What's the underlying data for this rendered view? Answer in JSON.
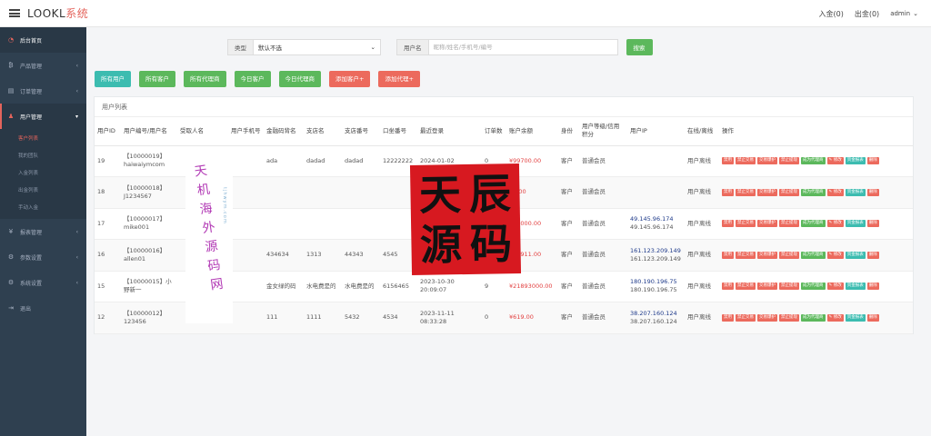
{
  "header": {
    "logo_main": "LOOKL",
    "logo_sys": "系统",
    "deposit": "入金(0)",
    "withdraw": "出金(0)",
    "user": "admin",
    "user_caret": "⌄"
  },
  "sidebar": {
    "items": [
      {
        "label": "后台首页",
        "icon": "dashboard-icon",
        "glyph": "◔"
      },
      {
        "label": "产品管理",
        "icon": "bitcoin-icon",
        "glyph": "₿"
      },
      {
        "label": "订单管理",
        "icon": "order-icon",
        "glyph": "▤"
      },
      {
        "label": "用户管理",
        "icon": "user-icon",
        "glyph": "♟"
      },
      {
        "label": "报表管理",
        "icon": "yen-icon",
        "glyph": "¥"
      },
      {
        "label": "参数设置",
        "icon": "settings-icon",
        "glyph": "⚙"
      },
      {
        "label": "系统设置",
        "icon": "gears-icon",
        "glyph": "⚙"
      },
      {
        "label": "退出",
        "icon": "logout-icon",
        "glyph": "⇥"
      }
    ],
    "submenu": [
      "客户列表",
      "我的团队",
      "入金列表",
      "出金列表",
      "手动入金"
    ]
  },
  "filter": {
    "type_label": "类型",
    "type_value": "默认不选",
    "user_label": "用户名",
    "user_placeholder": "昵称/姓名/手机号/编号",
    "search_btn": "搜索"
  },
  "tabs": [
    {
      "label": "所有用户",
      "color": "teal"
    },
    {
      "label": "所有客户",
      "color": "green"
    },
    {
      "label": "所有代理商",
      "color": "green"
    },
    {
      "label": "今日客户",
      "color": "green"
    },
    {
      "label": "今日代理商",
      "color": "green"
    },
    {
      "label": "添加客户+",
      "color": "red"
    },
    {
      "label": "添加代理+",
      "color": "red"
    }
  ],
  "panel_title": "用户列表",
  "table": {
    "headers": [
      "用户ID",
      "用户编号/用户名",
      "受取人名",
      "用户手机号",
      "金融码背名",
      "支店名",
      "支店番号",
      "口坐番号",
      "最近登录",
      "订单数",
      "账户余额",
      "身份",
      "用户等级/信用积分",
      "用户IP",
      "在线/离线",
      "操作"
    ],
    "rows": [
      {
        "id": "19",
        "name": "【10000019】haiwaiymcom",
        "recv": "",
        "phone": "",
        "bank": "ada",
        "branch": "dadad",
        "branch_no": "dadad",
        "acct": "12222222",
        "login": "2024-01-02",
        "orders": "0",
        "balance": "¥99700.00",
        "role": "客户",
        "level": "普通会员",
        "ip1": "",
        "ip2": "",
        "online": "用户离线"
      },
      {
        "id": "18",
        "name": "【10000018】J1234567",
        "recv": "",
        "phone": "",
        "bank": "",
        "branch": "",
        "branch_no": "",
        "acct": "",
        "login": "2024-01-0",
        "orders": "",
        "balance": "¥0.00",
        "role": "客户",
        "level": "普通会员",
        "ip1": "",
        "ip2": "",
        "online": "用户离线"
      },
      {
        "id": "17",
        "name": "【10000017】mike001",
        "recv": "",
        "phone": "",
        "bank": "",
        "branch": "",
        "branch_no": "",
        "acct": "",
        "login": "2023-10-",
        "orders": "",
        "balance": "¥59000.00",
        "role": "客户",
        "level": "普通会员",
        "ip1": "49.145.96.174",
        "ip2": "49.145.96.174",
        "online": "用户离线"
      },
      {
        "id": "16",
        "name": "【10000016】allen01",
        "recv": "",
        "phone": "",
        "bank": "434634",
        "branch": "1313",
        "branch_no": "44343",
        "acct": "4545",
        "login": "2023-11-",
        "orders": "0",
        "balance": "¥11911.00",
        "role": "客户",
        "level": "普通会员",
        "ip1": "161.123.209.149",
        "ip2": "161.123.209.149",
        "online": "用户离线"
      },
      {
        "id": "15",
        "name": "【10000015】小野新一",
        "recv": "",
        "phone": "",
        "bank": "金女绿的码",
        "branch": "水电费是的",
        "branch_no": "水电费是的",
        "acct": "6156465",
        "login": "2023-10-30 20:09:07",
        "orders": "9",
        "balance": "¥21893000.00",
        "role": "客户",
        "level": "普通会员",
        "ip1": "180.190.196.75",
        "ip2": "180.190.196.75",
        "online": "用户离线"
      },
      {
        "id": "12",
        "name": "【10000012】123456",
        "recv": "",
        "phone": "",
        "bank": "111",
        "branch": "1111",
        "branch_no": "5432",
        "acct": "4534",
        "login": "2023-11-11 08:33:28",
        "orders": "0",
        "balance": "¥619.00",
        "role": "客户",
        "level": "普通会员",
        "ip1": "38.207.160.124",
        "ip2": "38.207.160.124",
        "online": "用户离线"
      }
    ],
    "actions": [
      {
        "label": "禁用",
        "c": "r"
      },
      {
        "label": "禁止交易",
        "c": "r"
      },
      {
        "label": "交易爆护",
        "c": "r"
      },
      {
        "label": "禁止提现",
        "c": "r"
      },
      {
        "label": "成为代理商",
        "c": "g"
      },
      {
        "label": "✎ 修改",
        "c": "r"
      },
      {
        "label": "资金报表",
        "c": "t"
      },
      {
        "label": "删除",
        "c": "r"
      }
    ]
  },
  "watermark": {
    "stamp": [
      "天",
      "辰",
      "源",
      "码"
    ],
    "vertical_big": "天机海外源码网",
    "vertical_small": "tjhwym.com"
  }
}
